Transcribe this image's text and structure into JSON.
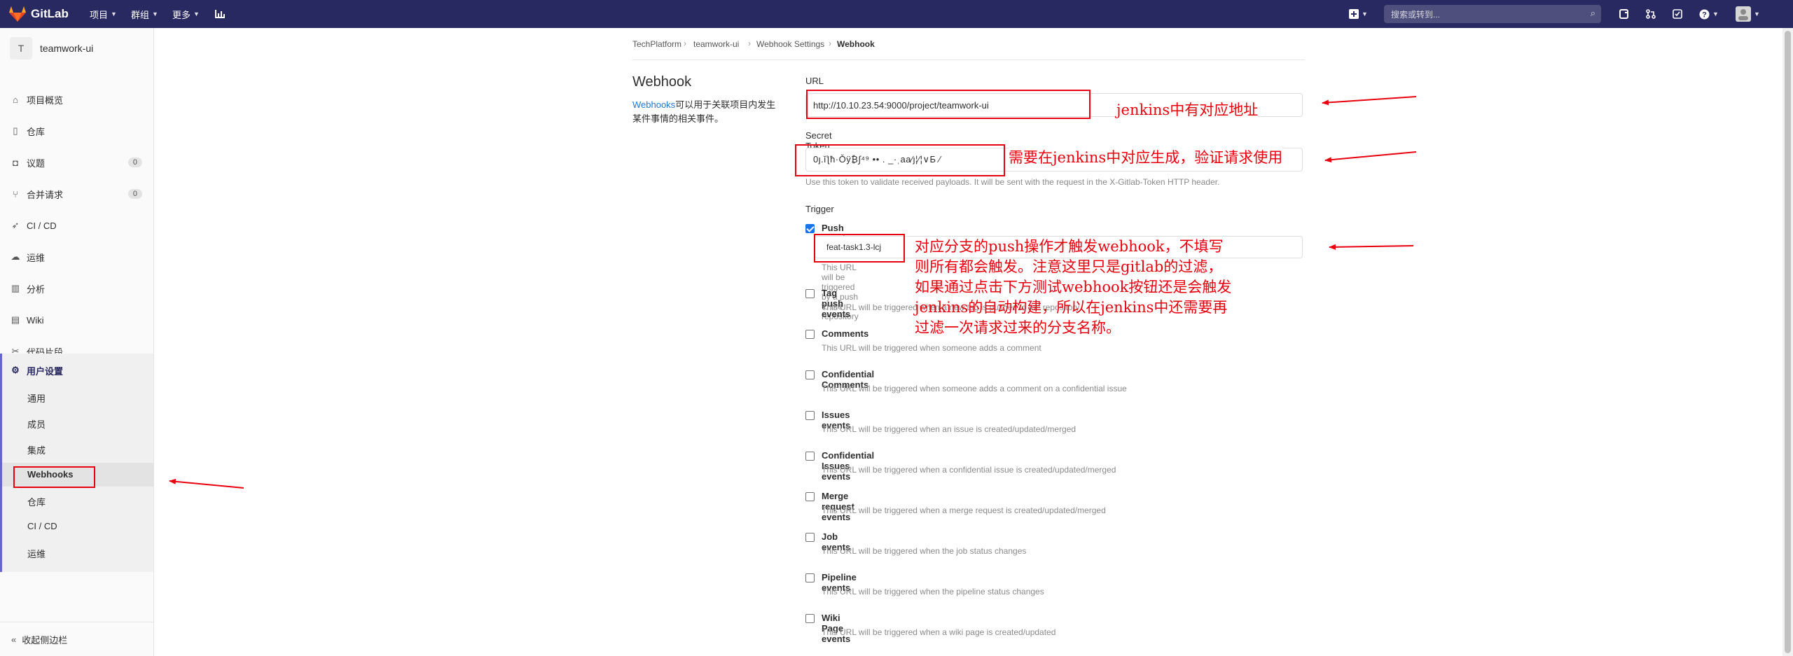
{
  "topbar": {
    "logo": "GitLab",
    "projects": "项目",
    "groups": "群组",
    "more": "更多",
    "search_placeholder": "搜索或转到..."
  },
  "sidebar": {
    "project_initial": "T",
    "project_name": "teamwork-ui",
    "items": [
      {
        "label": "项目概览",
        "icon": "home-icon"
      },
      {
        "label": "仓库",
        "icon": "doc-icon"
      },
      {
        "label": "议题",
        "icon": "issues-icon",
        "badge": "0"
      },
      {
        "label": "合并请求",
        "icon": "merge-request-icon",
        "badge": "0"
      },
      {
        "label": "CI / CD",
        "icon": "rocket-icon"
      },
      {
        "label": "运维",
        "icon": "cloud-icon"
      },
      {
        "label": "分析",
        "icon": "chart-icon"
      },
      {
        "label": "Wiki",
        "icon": "book-icon"
      },
      {
        "label": "代码片段",
        "icon": "scissors-icon"
      }
    ],
    "settings": {
      "label": "用户设置",
      "sub_items": [
        "通用",
        "成员",
        "集成",
        "Webhooks",
        "仓库",
        "CI / CD",
        "运维"
      ]
    },
    "collapse": "收起侧边栏"
  },
  "breadcrumb": [
    "TechPlatform",
    "teamwork-ui",
    "Webhook Settings",
    "Webhook"
  ],
  "page": {
    "title": "Webhook",
    "desc_link": "Webhooks",
    "desc_text": "可以用于关联项目内发生某件事情的相关事件。"
  },
  "form": {
    "url_label": "URL",
    "url_value": "http://10.10.23.54:9000/project/teamwork-ui",
    "token_label": "Secret Token",
    "token_value": "0ȷ.ǐƪħ·Ǒÿ₿∫⁴⁹ •• . _·ˌaa∕ȷ¦∕¦∨Б ∕",
    "token_help": "Use this token to validate received payloads. It will be sent with the request in the X-Gitlab-Token HTTP header.",
    "trigger_label": "Trigger",
    "push_branch": "feat-task1.3-lcj",
    "events": [
      {
        "name": "Push events",
        "desc": "This URL will be triggered by a push to the repository",
        "checked": true
      },
      {
        "name": "Tag push events",
        "desc": "This URL will be triggered when a new tag is pushed to the repository",
        "checked": false
      },
      {
        "name": "Comments",
        "desc": "This URL will be triggered when someone adds a comment",
        "checked": false
      },
      {
        "name": "Confidential Comments",
        "desc": "This URL will be triggered when someone adds a comment on a confidential issue",
        "checked": false
      },
      {
        "name": "Issues events",
        "desc": "This URL will be triggered when an issue is created/updated/merged",
        "checked": false
      },
      {
        "name": "Confidential Issues events",
        "desc": "This URL will be triggered when a confidential issue is created/updated/merged",
        "checked": false
      },
      {
        "name": "Merge request events",
        "desc": "This URL will be triggered when a merge request is created/updated/merged",
        "checked": false
      },
      {
        "name": "Job events",
        "desc": "This URL will be triggered when the job status changes",
        "checked": false
      },
      {
        "name": "Pipeline events",
        "desc": "This URL will be triggered when the pipeline status changes",
        "checked": false
      },
      {
        "name": "Wiki Page events",
        "desc": "This URL will be triggered when a wiki page is created/updated",
        "checked": false
      }
    ]
  },
  "annotations": {
    "url_note": "jenkins中有对应地址",
    "token_note": "需要在jenkins中对应生成，验证请求使用",
    "push_note": [
      "对应分支的push操作才触发webhook，不填写",
      "则所有都会触发。注意这里只是gitlab的过滤，",
      "如果通过点击下方测试webhook按钮还是会触发",
      "jenkins的自动构建，所以在jenkins中还需要再",
      "过滤一次请求过来的分支名称。"
    ],
    "color": "#e8000f"
  }
}
